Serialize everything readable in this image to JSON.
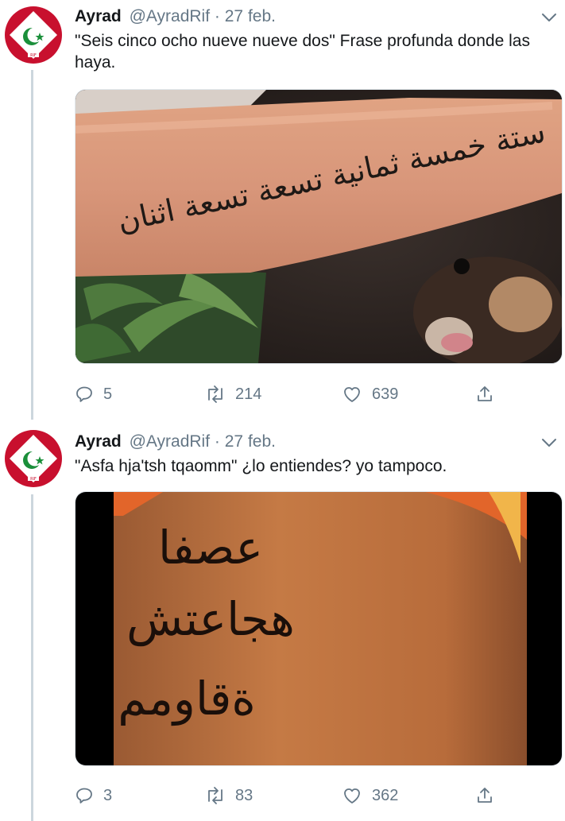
{
  "tweets": [
    {
      "author_name": "Ayrad",
      "handle": "@AyradRif",
      "separator": "·",
      "date": "27 feb.",
      "text": "\"Seis cinco ocho nueve nueve dos\" Frase profunda donde las haya.",
      "tattoo_text": "ستة خمسة ثمانية تسعة تسعة اثنان",
      "replies": "5",
      "retweets": "214",
      "likes": "639"
    },
    {
      "author_name": "Ayrad",
      "handle": "@AyradRif",
      "separator": "·",
      "date": "27 feb.",
      "text": "\"Asfa hja'tsh tqaomm\" ¿lo entiendes? yo tampoco.",
      "tattoo_lines": [
        "عصفا",
        "هجاعتش",
        "ةقاومم"
      ],
      "replies": "3",
      "retweets": "83",
      "likes": "362"
    }
  ],
  "avatar_label": "RIF",
  "colors": {
    "text_primary": "#14171a",
    "text_secondary": "#657786",
    "thread_line": "#ccd6dd",
    "flag_red": "#c8102e",
    "flag_green": "#1a8f3a"
  },
  "icons": [
    "chevron-down-icon",
    "reply-icon",
    "retweet-icon",
    "like-icon",
    "share-icon"
  ]
}
